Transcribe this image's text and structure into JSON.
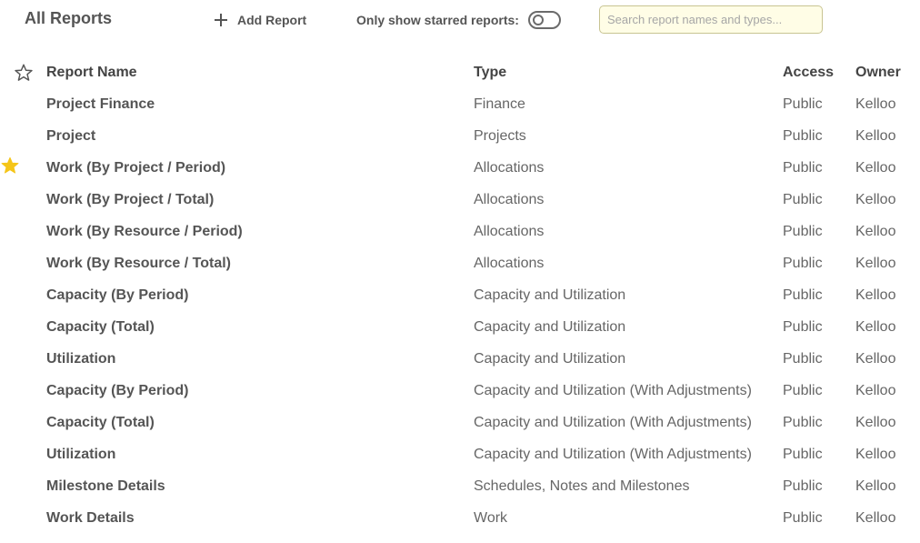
{
  "header": {
    "title": "All Reports",
    "add_report_label": "Add Report",
    "starred_filter_label": "Only show starred reports:",
    "starred_filter_on": false,
    "search_placeholder": "Search report names and types...",
    "search_value": ""
  },
  "table": {
    "columns": {
      "star_icon": "star-outline-icon",
      "name": "Report Name",
      "type": "Type",
      "access": "Access",
      "owner": "Owner"
    },
    "rows": [
      {
        "starred": false,
        "name": "Project Finance",
        "type": "Finance",
        "access": "Public",
        "owner": "Kelloo"
      },
      {
        "starred": false,
        "name": "Project",
        "type": "Projects",
        "access": "Public",
        "owner": "Kelloo"
      },
      {
        "starred": true,
        "name": "Work (By Project / Period)",
        "type": "Allocations",
        "access": "Public",
        "owner": "Kelloo"
      },
      {
        "starred": false,
        "name": "Work (By Project / Total)",
        "type": "Allocations",
        "access": "Public",
        "owner": "Kelloo"
      },
      {
        "starred": false,
        "name": "Work (By Resource / Period)",
        "type": "Allocations",
        "access": "Public",
        "owner": "Kelloo"
      },
      {
        "starred": false,
        "name": "Work (By Resource / Total)",
        "type": "Allocations",
        "access": "Public",
        "owner": "Kelloo"
      },
      {
        "starred": false,
        "name": "Capacity (By Period)",
        "type": "Capacity and Utilization",
        "access": "Public",
        "owner": "Kelloo"
      },
      {
        "starred": false,
        "name": "Capacity (Total)",
        "type": "Capacity and Utilization",
        "access": "Public",
        "owner": "Kelloo"
      },
      {
        "starred": false,
        "name": "Utilization",
        "type": "Capacity and Utilization",
        "access": "Public",
        "owner": "Kelloo"
      },
      {
        "starred": false,
        "name": "Capacity (By Period)",
        "type": "Capacity and Utilization (With Adjustments)",
        "access": "Public",
        "owner": "Kelloo"
      },
      {
        "starred": false,
        "name": "Capacity (Total)",
        "type": "Capacity and Utilization (With Adjustments)",
        "access": "Public",
        "owner": "Kelloo"
      },
      {
        "starred": false,
        "name": "Utilization",
        "type": "Capacity and Utilization (With Adjustments)",
        "access": "Public",
        "owner": "Kelloo"
      },
      {
        "starred": false,
        "name": "Milestone Details",
        "type": "Schedules, Notes and Milestones",
        "access": "Public",
        "owner": "Kelloo"
      },
      {
        "starred": false,
        "name": "Work Details",
        "type": "Work",
        "access": "Public",
        "owner": "Kelloo"
      }
    ]
  },
  "colors": {
    "star_filled": "#f5c518",
    "star_outline": "#555555",
    "search_background": "#fffde6",
    "search_border": "#c8c492",
    "text_primary": "#555555"
  }
}
